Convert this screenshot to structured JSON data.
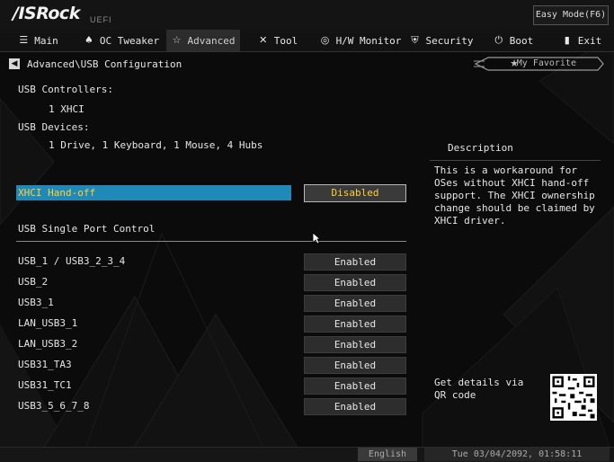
{
  "brand": {
    "logo": "/ISRock",
    "sub": "UEFI"
  },
  "easy_mode": "Easy Mode(F6)",
  "tabs": [
    {
      "icon": "☰",
      "label": "Main"
    },
    {
      "icon": "♠",
      "label": "OC Tweaker"
    },
    {
      "icon": "☆",
      "label": "Advanced"
    },
    {
      "icon": "✕",
      "label": "Tool"
    },
    {
      "icon": "◎",
      "label": "H/W Monitor"
    },
    {
      "icon": "⛨",
      "label": "Security"
    },
    {
      "icon": "⏻",
      "label": "Boot"
    },
    {
      "icon": "▮",
      "label": "Exit"
    }
  ],
  "breadcrumb": "Advanced\\USB Configuration",
  "favorite": {
    "label": "My Favorite",
    "star": "★"
  },
  "usb_controllers": {
    "heading": "USB Controllers:",
    "value": "1 XHCI"
  },
  "usb_devices": {
    "heading": "USB Devices:",
    "value": "1 Drive, 1 Keyboard, 1 Mouse, 4 Hubs"
  },
  "xhci_handoff": {
    "label": "XHCI Hand-off",
    "value": "Disabled"
  },
  "single_port": {
    "heading": "USB Single Port Control"
  },
  "ports": [
    {
      "label": "USB_1 / USB3_2_3_4",
      "value": "Enabled"
    },
    {
      "label": "USB_2",
      "value": "Enabled"
    },
    {
      "label": "USB3_1",
      "value": "Enabled"
    },
    {
      "label": "LAN_USB3_1",
      "value": "Enabled"
    },
    {
      "label": "LAN_USB3_2",
      "value": "Enabled"
    },
    {
      "label": "USB31_TA3",
      "value": "Enabled"
    },
    {
      "label": "USB31_TC1",
      "value": "Enabled"
    },
    {
      "label": "USB3_5_6_7_8",
      "value": "Enabled"
    }
  ],
  "description": {
    "title": "Description",
    "body": "This is a workaround for OSes without XHCI hand-off support. The XHCI ownership change should be claimed by XHCI driver."
  },
  "qr": {
    "text": "Get details via QR code"
  },
  "footer": {
    "language": "English",
    "datetime": "Tue 03/04/2092, 01:58:11"
  },
  "colors": {
    "highlight": "#1f8ab8",
    "selected_text": "#ffd03a",
    "active_tab": "#2c2c2c"
  }
}
